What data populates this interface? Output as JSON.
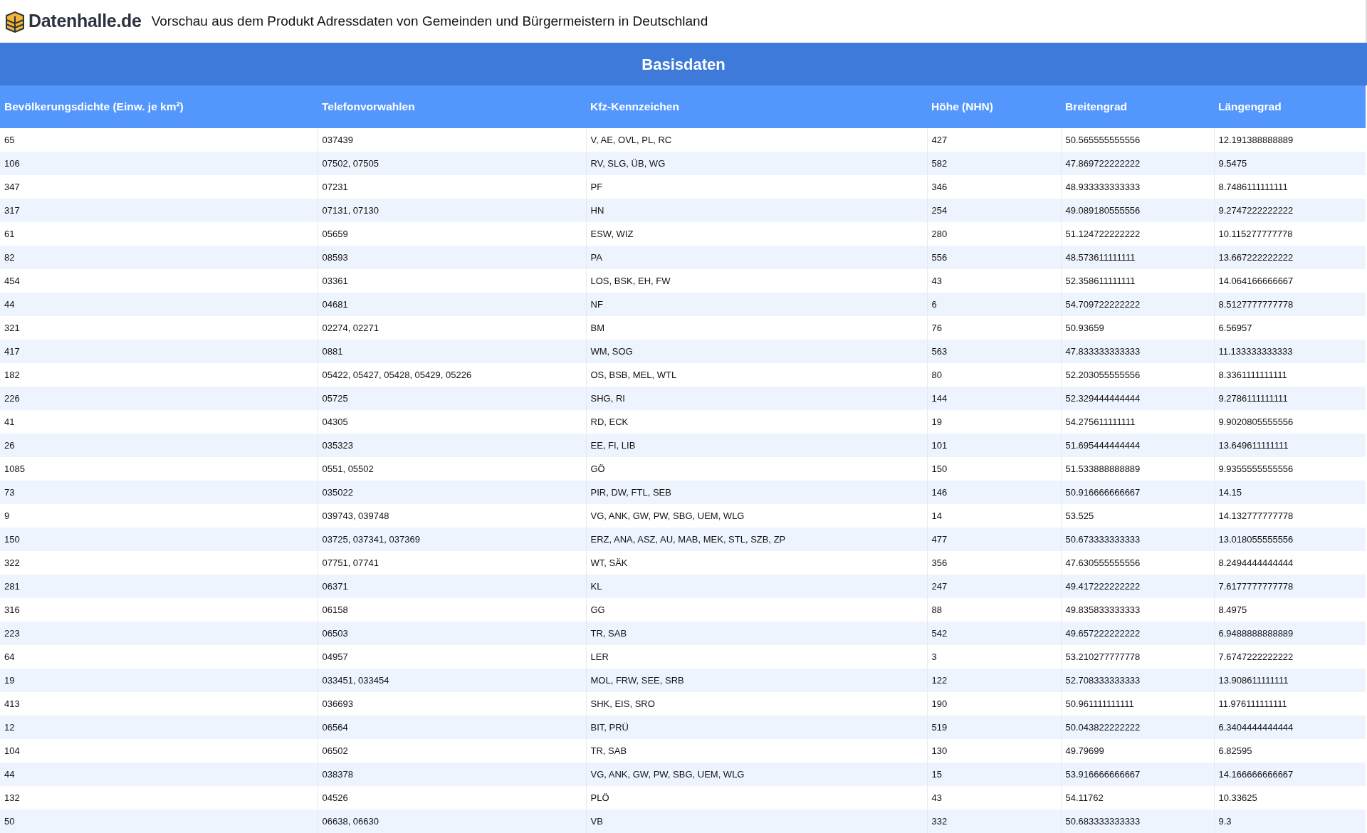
{
  "header": {
    "logo_text": "Datenhalle.de",
    "title": "Vorschau aus dem Produkt Adressdaten von Gemeinden und Bürgermeistern in Deutschland"
  },
  "table": {
    "caption": "Basisdaten",
    "columns": [
      "Bevölkerungsdichte (Einw. je km²)",
      "Telefonvorwahlen",
      "Kfz-Kennzeichen",
      "Höhe (NHN)",
      "Breitengrad",
      "Längengrad"
    ],
    "rows": [
      [
        "65",
        "037439",
        "V, AE, OVL, PL, RC",
        "427",
        "50.565555555556",
        "12.191388888889"
      ],
      [
        "106",
        "07502, 07505",
        "RV, SLG, ÜB, WG",
        "582",
        "47.869722222222",
        "9.5475"
      ],
      [
        "347",
        "07231",
        "PF",
        "346",
        "48.933333333333",
        "8.7486111111111"
      ],
      [
        "317",
        "07131, 07130",
        "HN",
        "254",
        "49.089180555556",
        "9.2747222222222"
      ],
      [
        "61",
        "05659",
        "ESW, WIZ",
        "280",
        "51.124722222222",
        "10.115277777778"
      ],
      [
        "82",
        "08593",
        "PA",
        "556",
        "48.573611111111",
        "13.667222222222"
      ],
      [
        "454",
        "03361",
        "LOS, BSK, EH, FW",
        "43",
        "52.358611111111",
        "14.064166666667"
      ],
      [
        "44",
        "04681",
        "NF",
        "6",
        "54.709722222222",
        "8.5127777777778"
      ],
      [
        "321",
        "02274, 02271",
        "BM",
        "76",
        "50.93659",
        "6.56957"
      ],
      [
        "417",
        "0881",
        "WM, SOG",
        "563",
        "47.833333333333",
        "11.133333333333"
      ],
      [
        "182",
        "05422, 05427, 05428, 05429, 05226",
        "OS, BSB, MEL, WTL",
        "80",
        "52.203055555556",
        "8.3361111111111"
      ],
      [
        "226",
        "05725",
        "SHG, RI",
        "144",
        "52.329444444444",
        "9.2786111111111"
      ],
      [
        "41",
        "04305",
        "RD, ECK",
        "19",
        "54.275611111111",
        "9.9020805555556"
      ],
      [
        "26",
        "035323",
        "EE, FI, LIB",
        "101",
        "51.695444444444",
        "13.649611111111"
      ],
      [
        "1085",
        "0551, 05502",
        "GÖ",
        "150",
        "51.533888888889",
        "9.9355555555556"
      ],
      [
        "73",
        "035022",
        "PIR, DW, FTL, SEB",
        "146",
        "50.916666666667",
        "14.15"
      ],
      [
        "9",
        "039743, 039748",
        "VG, ANK, GW, PW, SBG, UEM, WLG",
        "14",
        "53.525",
        "14.132777777778"
      ],
      [
        "150",
        "03725, 037341, 037369",
        "ERZ, ANA, ASZ, AU, MAB, MEK, STL, SZB, ZP",
        "477",
        "50.673333333333",
        "13.018055555556"
      ],
      [
        "322",
        "07751, 07741",
        "WT, SÄK",
        "356",
        "47.630555555556",
        "8.2494444444444"
      ],
      [
        "281",
        "06371",
        "KL",
        "247",
        "49.417222222222",
        "7.6177777777778"
      ],
      [
        "316",
        "06158",
        "GG",
        "88",
        "49.835833333333",
        "8.4975"
      ],
      [
        "223",
        "06503",
        "TR, SAB",
        "542",
        "49.657222222222",
        "6.9488888888889"
      ],
      [
        "64",
        "04957",
        "LER",
        "3",
        "53.210277777778",
        "7.6747222222222"
      ],
      [
        "19",
        "033451, 033454",
        "MOL, FRW, SEE, SRB",
        "122",
        "52.708333333333",
        "13.908611111111"
      ],
      [
        "413",
        "036693",
        "SHK, EIS, SRO",
        "190",
        "50.961111111111",
        "11.976111111111"
      ],
      [
        "12",
        "06564",
        "BIT, PRÜ",
        "519",
        "50.043822222222",
        "6.3404444444444"
      ],
      [
        "104",
        "06502",
        "TR, SAB",
        "130",
        "49.79699",
        "6.82595"
      ],
      [
        "44",
        "038378",
        "VG, ANK, GW, PW, SBG, UEM, WLG",
        "15",
        "53.916666666667",
        "14.166666666667"
      ],
      [
        "132",
        "04526",
        "PLÖ",
        "43",
        "54.11762",
        "10.33625"
      ],
      [
        "50",
        "06638, 06630",
        "VB",
        "332",
        "50.683333333333",
        "9.3"
      ]
    ]
  }
}
